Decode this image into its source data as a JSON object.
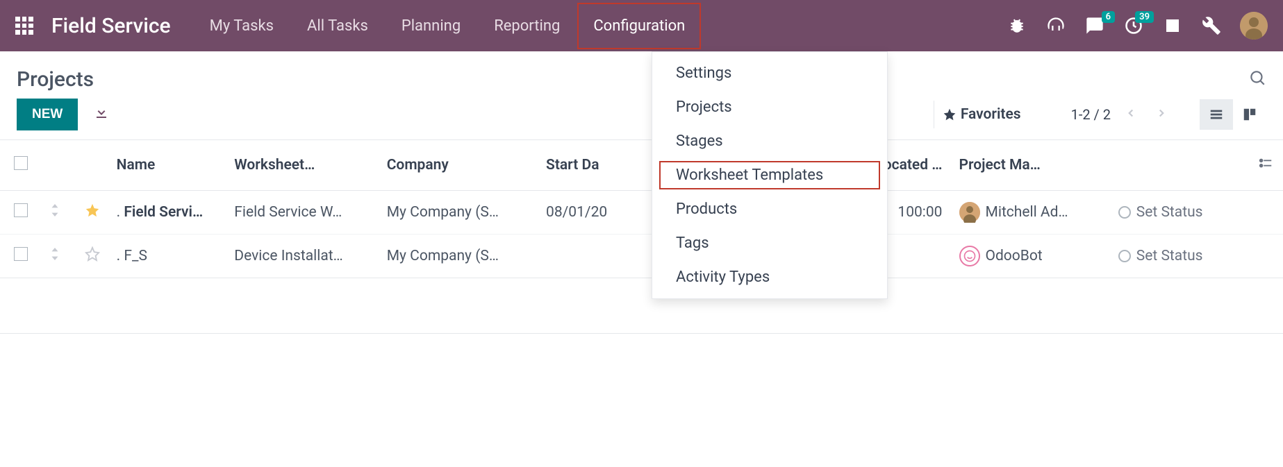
{
  "app": {
    "title": "Field Service"
  },
  "nav": {
    "items": [
      {
        "label": "My Tasks"
      },
      {
        "label": "All Tasks"
      },
      {
        "label": "Planning"
      },
      {
        "label": "Reporting"
      },
      {
        "label": "Configuration",
        "active": true
      }
    ]
  },
  "topbar": {
    "badges": {
      "messages": "6",
      "activities": "39"
    }
  },
  "dropdown": {
    "items": [
      {
        "label": "Settings"
      },
      {
        "label": "Projects"
      },
      {
        "label": "Stages"
      },
      {
        "label": "Worksheet Templates",
        "highlight": true
      },
      {
        "label": "Products"
      },
      {
        "label": "Tags"
      },
      {
        "label": "Activity Types"
      }
    ]
  },
  "page": {
    "title": "Projects",
    "new_button": "NEW"
  },
  "toolbar": {
    "favorites": "Favorites",
    "pager": "1-2 / 2"
  },
  "table": {
    "headers": {
      "name": "Name",
      "worksheet": "Worksheet…",
      "company": "Company",
      "start": "Start Da",
      "allocated": "located …",
      "manager": "Project Ma…"
    },
    "rows": [
      {
        "starred": true,
        "name_prefix": ". ",
        "name": "Field Servi…",
        "worksheet": "Field Service W…",
        "company": "My Company (S…",
        "start": "08/01/20",
        "allocated": "100:00",
        "manager": "Mitchell Ad…",
        "manager_type": "photo",
        "status": "Set Status"
      },
      {
        "starred": false,
        "name_prefix": ". ",
        "name": "F_S",
        "worksheet": "Device Installat…",
        "company": "My Company (S…",
        "start": "",
        "allocated": "",
        "manager": "OdooBot",
        "manager_type": "bot",
        "status": "Set Status"
      }
    ]
  }
}
